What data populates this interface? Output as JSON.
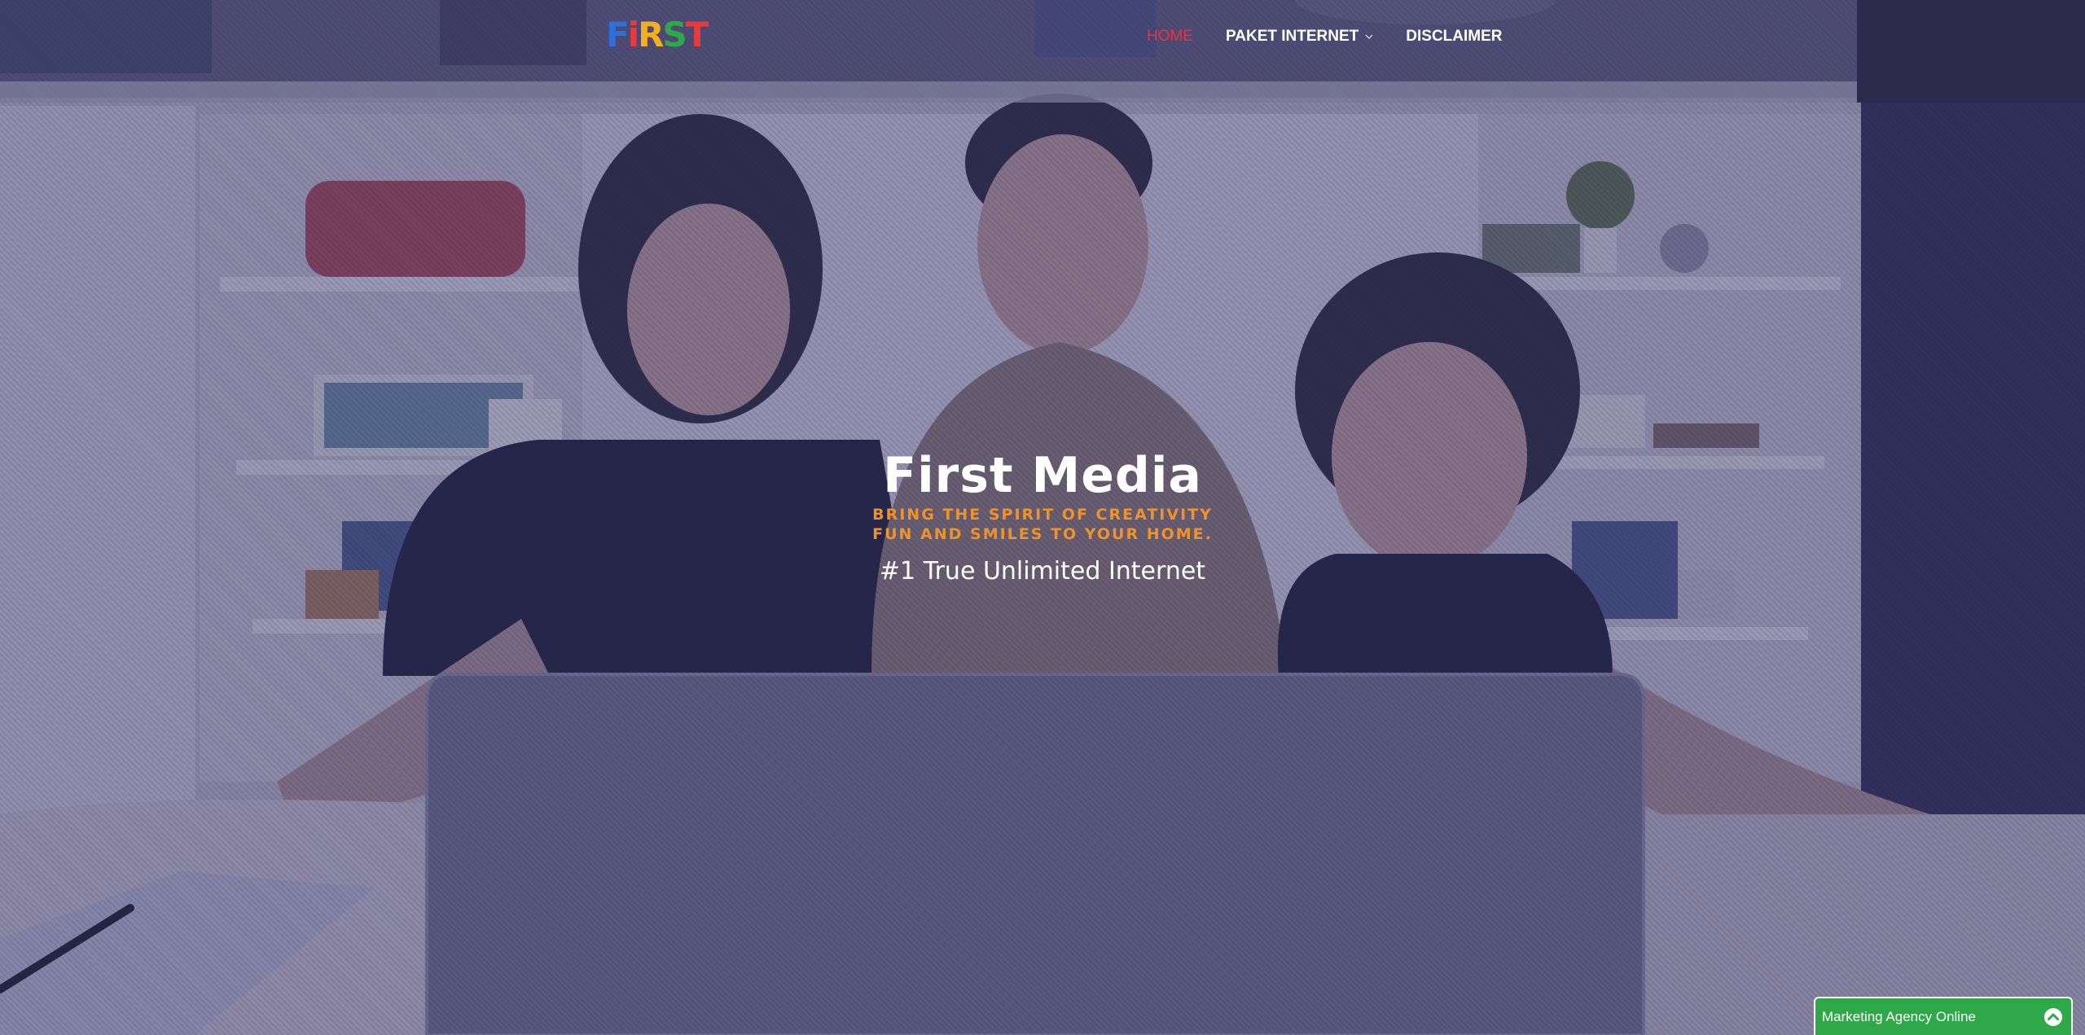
{
  "header": {
    "logo": {
      "letters": [
        "F",
        "i",
        "R",
        "S",
        "T"
      ],
      "colors": [
        "#2e6fd8",
        "#e83a3a",
        "#f0b020",
        "#2fa84a",
        "#e83a3a"
      ],
      "icon": "first-media-logo"
    },
    "nav": [
      {
        "label": "HOME",
        "active": true
      },
      {
        "label": "PAKET INTERNET",
        "has_dropdown": true,
        "icon": "chevron-down-icon"
      },
      {
        "label": "DISCLAIMER"
      }
    ]
  },
  "hero": {
    "title": "First Media",
    "tagline_line1": "BRING THE SPIRIT OF CREATIVITY",
    "tagline_line2": "FUN AND SMILES TO YOUR HOME.",
    "subtitle": "#1 True Unlimited Internet"
  },
  "chat_widget": {
    "label": "Marketing Agency Online",
    "icon": "chevron-up-circle-icon",
    "color": "#2fa84a"
  },
  "colors": {
    "nav_active": "#e8323c",
    "tagline": "#f0922a",
    "overlay": "#3a3870"
  }
}
